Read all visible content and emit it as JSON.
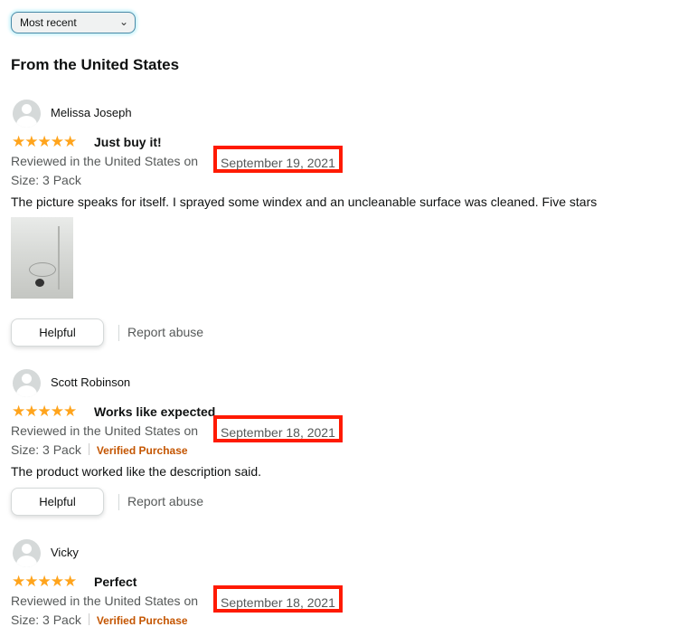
{
  "sort": {
    "selected": "Most recent",
    "chevron_icon": "chevron-down-icon"
  },
  "section_title": "From the United States",
  "colors": {
    "star": "#ffa41c",
    "verified": "#c45500",
    "highlight_box": "#ff1a00"
  },
  "reviews": [
    {
      "name": "Melissa Joseph",
      "stars": "★★★★★",
      "rating": 5,
      "title": "Just buy it!",
      "reviewed_prefix": "Reviewed in the United States on",
      "date": "September 19, 2021",
      "size": "Size: 3 Pack",
      "body": "The picture speaks for itself. I sprayed some windex and an uncleanable surface was cleaned. Five stars",
      "helpful": "Helpful",
      "report": "Report abuse"
    },
    {
      "name": "Scott Robinson",
      "stars": "★★★★★",
      "rating": 5,
      "title": "Works like expected",
      "reviewed_prefix": "Reviewed in the United States on",
      "date": "September 18, 2021",
      "size": "Size: 3 Pack",
      "verified": "Verified Purchase",
      "body": "The product worked like the description said.",
      "helpful": "Helpful",
      "report": "Report abuse"
    },
    {
      "name": "Vicky",
      "stars": "★★★★★",
      "rating": 5,
      "title": "Perfect",
      "reviewed_prefix": "Reviewed in the United States on",
      "date": "September 18, 2021",
      "size": "Size: 3 Pack",
      "verified": "Verified Purchase"
    }
  ]
}
